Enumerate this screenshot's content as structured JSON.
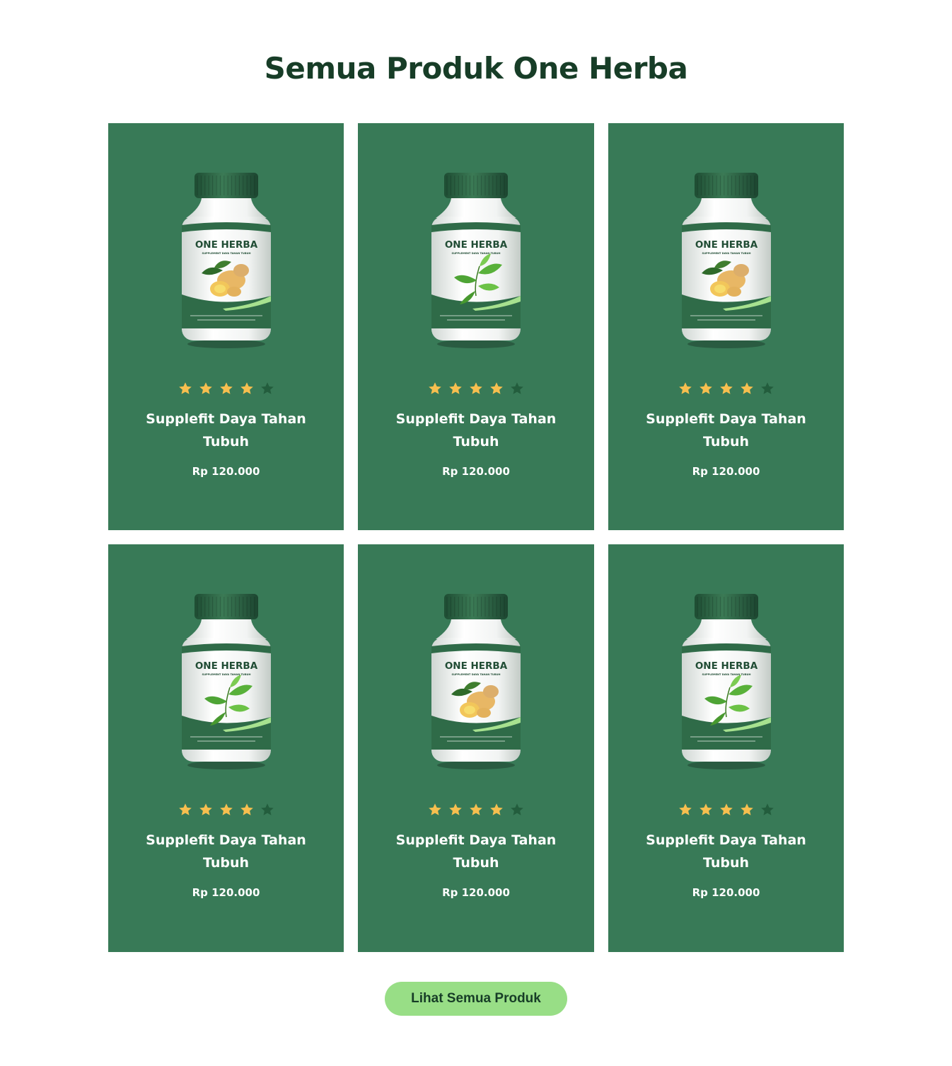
{
  "page": {
    "title": "Semua Produk One Herba"
  },
  "products": [
    {
      "name": "Supplefit Daya Tahan Tubuh",
      "price": "Rp 120.000",
      "rating": 4,
      "max_rating": 5,
      "label_brand": "ONE HERBA",
      "label_sub": "SUPPLEMENT DAYA TAHAN TUBUH",
      "herb": "ginger"
    },
    {
      "name": "Supplefit Daya Tahan Tubuh",
      "price": "Rp 120.000",
      "rating": 4,
      "max_rating": 5,
      "label_brand": "ONE HERBA",
      "label_sub": "SUPPLEMENT DAYA TAHAN TUBUH",
      "herb": "leaf"
    },
    {
      "name": "Supplefit Daya Tahan Tubuh",
      "price": "Rp 120.000",
      "rating": 4,
      "max_rating": 5,
      "label_brand": "ONE HERBA",
      "label_sub": "SUPPLEMENT DAYA TAHAN TUBUH",
      "herb": "ginger"
    },
    {
      "name": "Supplefit Daya Tahan Tubuh",
      "price": "Rp 120.000",
      "rating": 4,
      "max_rating": 5,
      "label_brand": "ONE HERBA",
      "label_sub": "SUPPLEMENT DAYA TAHAN TUBUH",
      "herb": "leaf"
    },
    {
      "name": "Supplefit Daya Tahan Tubuh",
      "price": "Rp 120.000",
      "rating": 4,
      "max_rating": 5,
      "label_brand": "ONE HERBA",
      "label_sub": "SUPPLEMENT DAYA TAHAN TUBUH",
      "herb": "ginger"
    },
    {
      "name": "Supplefit Daya Tahan Tubuh",
      "price": "Rp 120.000",
      "rating": 4,
      "max_rating": 5,
      "label_brand": "ONE HERBA",
      "label_sub": "SUPPLEMENT DAYA TAHAN TUBUH",
      "herb": "leaf"
    }
  ],
  "cta": {
    "label": "Lihat Semua Produk"
  },
  "colors": {
    "title": "#173d27",
    "card_bg": "#387a57",
    "star_filled": "#f7bf4f",
    "star_empty": "#235d3d",
    "cta_bg": "#98de86",
    "cta_text": "#173d27",
    "bottle_green": "#2f6b48"
  },
  "icons": {
    "star": "star-icon",
    "product": "supplement-bottle-image"
  }
}
